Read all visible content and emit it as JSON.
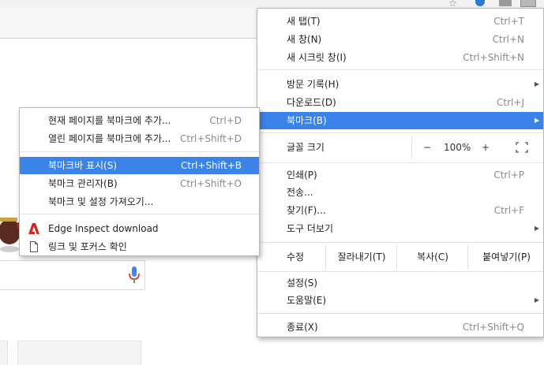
{
  "main_menu": {
    "new_tab": {
      "label": "새 탭(T)",
      "shortcut": "Ctrl+T"
    },
    "new_window": {
      "label": "새 창(N)",
      "shortcut": "Ctrl+N"
    },
    "new_incognito": {
      "label": "새 시크릿 창(I)",
      "shortcut": "Ctrl+Shift+N"
    },
    "history": {
      "label": "방문 기록(H)"
    },
    "downloads": {
      "label": "다운로드(D)",
      "shortcut": "Ctrl+J"
    },
    "bookmarks": {
      "label": "북마크(B)"
    },
    "zoom": {
      "label": "글꼴 크기",
      "minus": "−",
      "value": "100%",
      "plus": "+"
    },
    "print": {
      "label": "인쇄(P)",
      "shortcut": "Ctrl+P"
    },
    "cast": {
      "label": "전송..."
    },
    "find": {
      "label": "찾기(F)...",
      "shortcut": "Ctrl+F"
    },
    "more_tools": {
      "label": "도구 더보기"
    },
    "edit": {
      "label": "수정",
      "cut": "잘라내기(T)",
      "copy": "복사(C)",
      "paste": "붙여넣기(P)"
    },
    "settings": {
      "label": "설정(S)"
    },
    "help": {
      "label": "도움말(E)"
    },
    "exit": {
      "label": "종료(X)",
      "shortcut": "Ctrl+Shift+Q"
    }
  },
  "bookmarks_submenu": {
    "bookmark_page": {
      "label": "현재 페이지를 북마크에 추가...",
      "shortcut": "Ctrl+D"
    },
    "bookmark_open_pages": {
      "label": "열린 페이지를 북마크에 추가...",
      "shortcut": "Ctrl+Shift+D"
    },
    "show_bookmarks_bar": {
      "label": "북마크바 표시(S)",
      "shortcut": "Ctrl+Shift+B"
    },
    "bookmark_manager": {
      "label": "북마크 관리자(B)",
      "shortcut": "Ctrl+Shift+O"
    },
    "import_bookmarks": {
      "label": "북마크 및 설정 가져오기..."
    },
    "edge_inspect": {
      "label": "Edge Inspect download"
    },
    "link_focus": {
      "label": "링크 및 포커스 확인"
    }
  },
  "colors": {
    "highlight": "#3b83e8",
    "adobe_red": "#d4251b",
    "mic_blue": "#4285f4"
  }
}
